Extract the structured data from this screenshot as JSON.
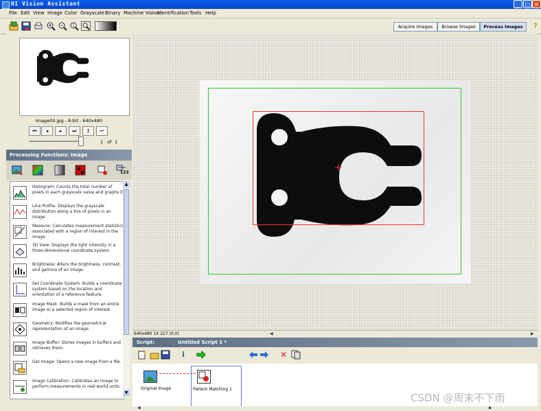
{
  "window": {
    "title": "NI Vision Assistant",
    "buttons": {
      "minimize": "_",
      "maximize": "□",
      "close": "×"
    }
  },
  "menu": [
    "File",
    "Edit",
    "View",
    "Image",
    "Color",
    "Grayscale",
    "Binary",
    "Machine Vision",
    "Identification",
    "Tools",
    "Help"
  ],
  "mode_tabs": {
    "acquire": "Acquire Images",
    "browse": "Browse Images",
    "process": "Process Images",
    "active": "Process Images"
  },
  "help_icon": "?",
  "browser": {
    "image_info": "Image00.jpg - 8-bit - 640x480",
    "page_current": "1",
    "page_of": "of",
    "page_total": "1"
  },
  "processing": {
    "header": "Processing Functions: Image",
    "categories": [
      "image-icon",
      "color-icon",
      "grayscale-icon",
      "binary-icon",
      "machine-vision-icon",
      "identification-icon"
    ],
    "identification_label": "123",
    "functions": [
      {
        "icon": "histogram-icon",
        "text": "Histogram: Counts the total number of pixels in each grayscale value and graphs it."
      },
      {
        "icon": "line-profile-icon",
        "text": "Line Profile: Displays the grayscale distribution along a line of pixels in an image."
      },
      {
        "icon": "measure-icon",
        "text": "Measure: Calculates measurement statistics associated with a region of interest in the image."
      },
      {
        "icon": "3d-view-icon",
        "text": "3D View: Displays the light intensity in a three-dimensional coordinate system."
      },
      {
        "icon": "brightness-icon",
        "text": "Brightness: Alters the brightness, contrast, and gamma of an image."
      },
      {
        "icon": "coordinate-system-icon",
        "text": "Set Coordinate System: Builds a coordinate system based on the location and orientation of a reference feature."
      },
      {
        "icon": "image-mask-icon",
        "text": "Image Mask: Builds a mask from an entire image or a selected region of interest."
      },
      {
        "icon": "geometry-icon",
        "text": "Geometry: Modifies the geometrical representation of an image."
      },
      {
        "icon": "image-buffer-icon",
        "text": "Image Buffer: Stores images in buffers and retrieves them."
      },
      {
        "icon": "get-image-icon",
        "text": "Get Image: Opens a new image from a file."
      },
      {
        "icon": "calibration-icon",
        "text": "Image Calibration: Calibrates an image to perform measurements in real-world units."
      }
    ]
  },
  "status": {
    "text": "640x480 1X 227     (0,0)"
  },
  "script": {
    "label": "Script:",
    "name": "Untitled Script 1 *",
    "steps": [
      {
        "label": "Original Image"
      },
      {
        "label": "Pattern Matching 1"
      }
    ]
  },
  "watermark": "CSDN @周末不下雨",
  "colors": {
    "titlebar": "#0845c7",
    "panel_header": "#5c6f85",
    "roi_green": "#2fc82f",
    "roi_red": "#e33333"
  }
}
